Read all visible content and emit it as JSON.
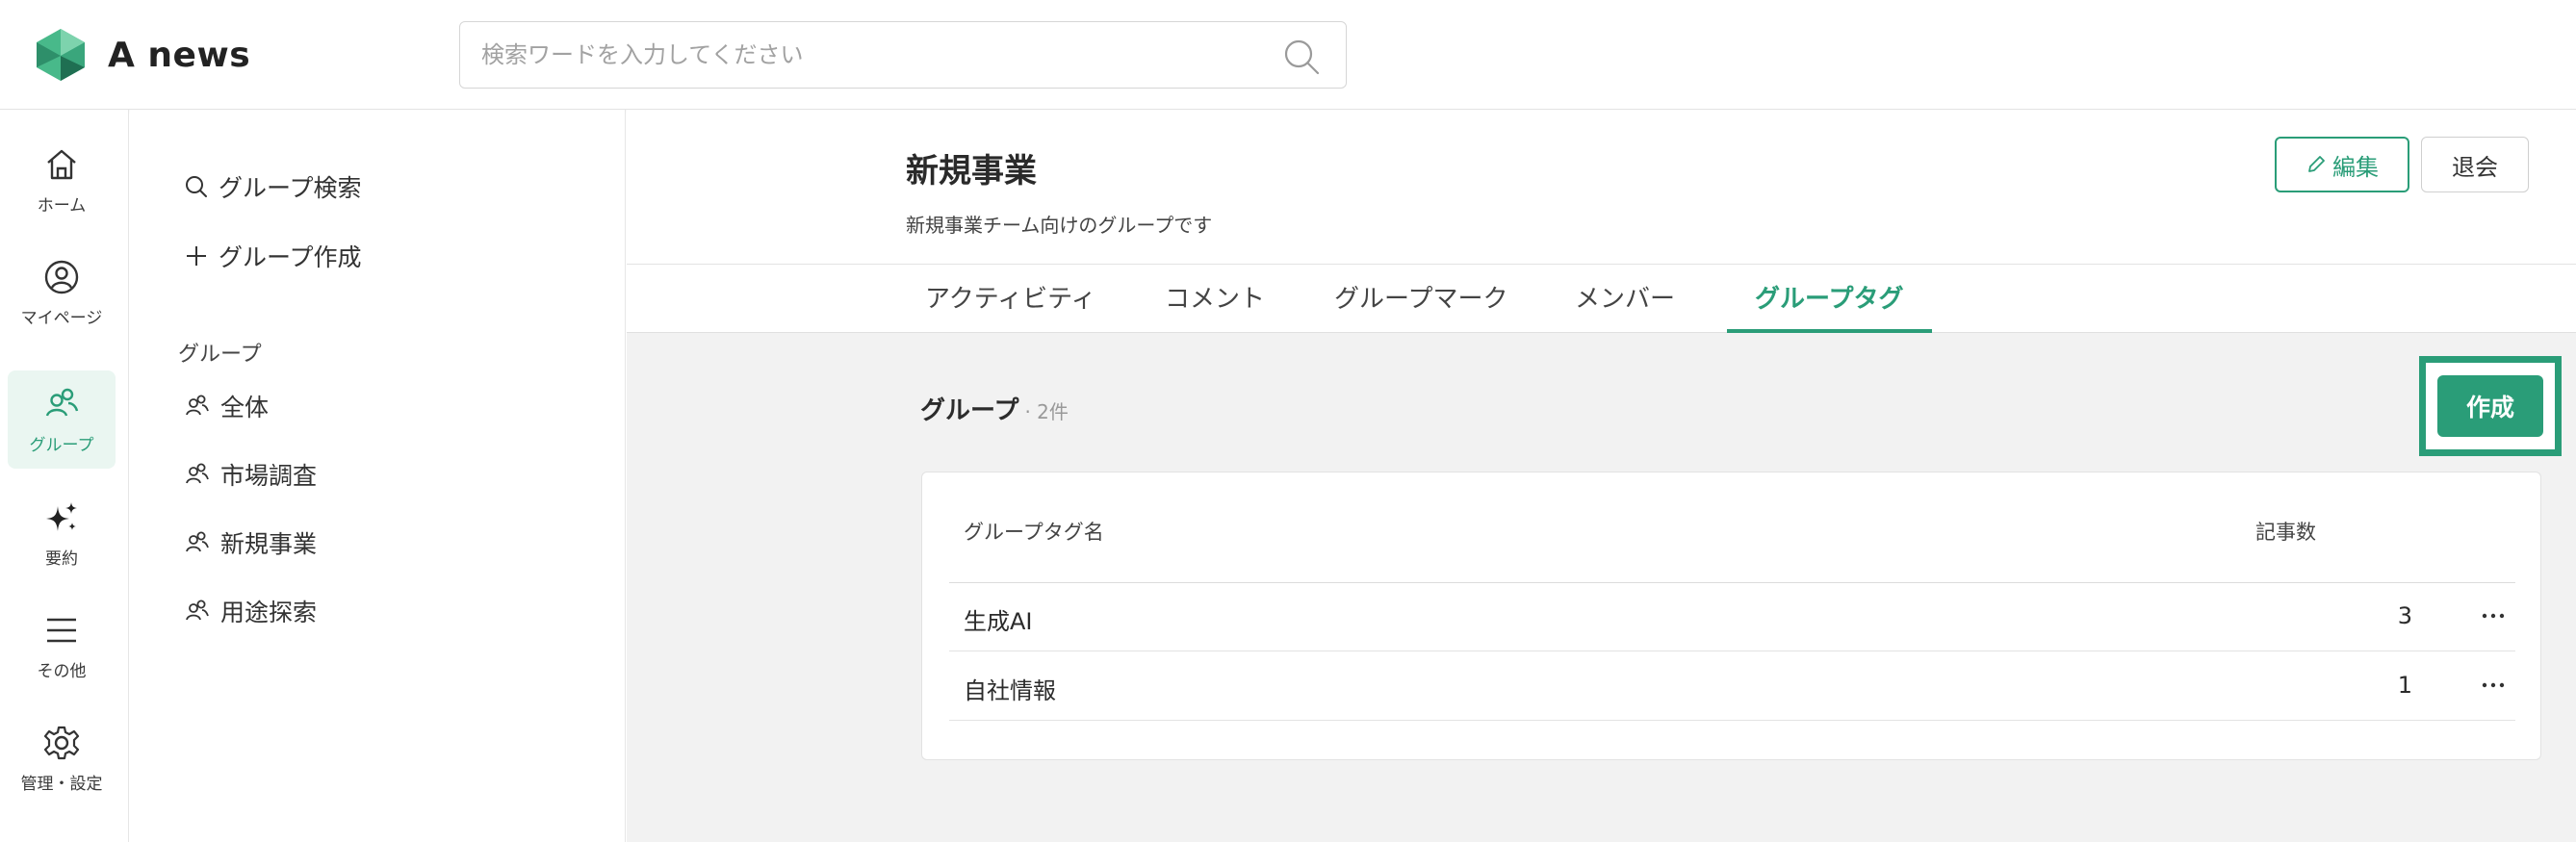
{
  "app": {
    "name": "A news"
  },
  "search": {
    "placeholder": "検索ワードを入力してください",
    "value": ""
  },
  "rail": {
    "items": [
      {
        "label": "ホーム",
        "icon": "home-icon"
      },
      {
        "label": "マイページ",
        "icon": "user-circle-icon"
      },
      {
        "label": "グループ",
        "icon": "group-icon",
        "active": true
      },
      {
        "label": "要約",
        "icon": "sparkle-icon"
      },
      {
        "label": "その他",
        "icon": "menu-icon"
      },
      {
        "label": "管理・設定",
        "icon": "gear-icon"
      }
    ]
  },
  "group_sidebar": {
    "actions": [
      {
        "label": "グループ検索",
        "icon": "search-icon"
      },
      {
        "label": "グループ作成",
        "icon": "plus-icon"
      }
    ],
    "section_label": "グループ",
    "groups": [
      {
        "label": "全体"
      },
      {
        "label": "市場調査"
      },
      {
        "label": "新規事業"
      },
      {
        "label": "用途探索"
      }
    ]
  },
  "group": {
    "title": "新規事業",
    "description": "新規事業チーム向けのグループです",
    "edit_label": "編集",
    "leave_label": "退会"
  },
  "tabs": [
    {
      "label": "アクティビティ"
    },
    {
      "label": "コメント"
    },
    {
      "label": "グループマーク"
    },
    {
      "label": "メンバー"
    },
    {
      "label": "グループタグ",
      "active": true
    }
  ],
  "tag_section": {
    "title": "グループ",
    "count_label": "· 2件",
    "create_label": "作成",
    "columns": {
      "name": "グループタグ名",
      "count": "記事数"
    },
    "rows": [
      {
        "name": "生成AI",
        "count": "3"
      },
      {
        "name": "自社情報",
        "count": "1"
      }
    ]
  },
  "colors": {
    "accent": "#2a9d78",
    "main_bg": "#f2f2f2",
    "active_rail_bg": "#eaf6f1"
  }
}
